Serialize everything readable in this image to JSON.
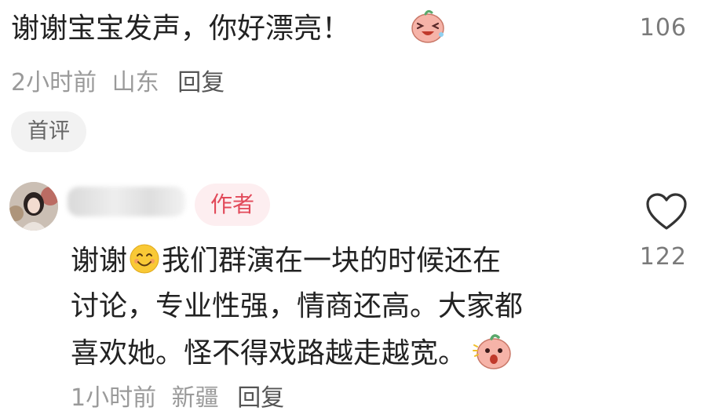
{
  "comment1": {
    "text": "谢谢宝宝发声，你好漂亮！",
    "emoji": "laughing-blob-emoji",
    "like_count": "106",
    "time": "2小时前",
    "location": "山东",
    "reply_label": "回复",
    "tag": "首评"
  },
  "comment2": {
    "badge": "作者",
    "lines": [
      {
        "before": "谢谢",
        "after": "我们群演在一块的时候还在"
      },
      {
        "text": "讨论，专业性强，情商还高。大家都"
      },
      {
        "text": "喜欢她。怪不得戏路越走越宽。"
      }
    ],
    "inline_emoji_1": "smiling-face-emoji",
    "inline_emoji_2": "surprised-blob-emoji",
    "like_count": "122",
    "time": "1小时前",
    "location": "新疆",
    "reply_label": "回复"
  },
  "colors": {
    "badge_bg": "#fdeef0",
    "badge_text": "#e24a5a",
    "meta_text": "#9a9a9a"
  }
}
